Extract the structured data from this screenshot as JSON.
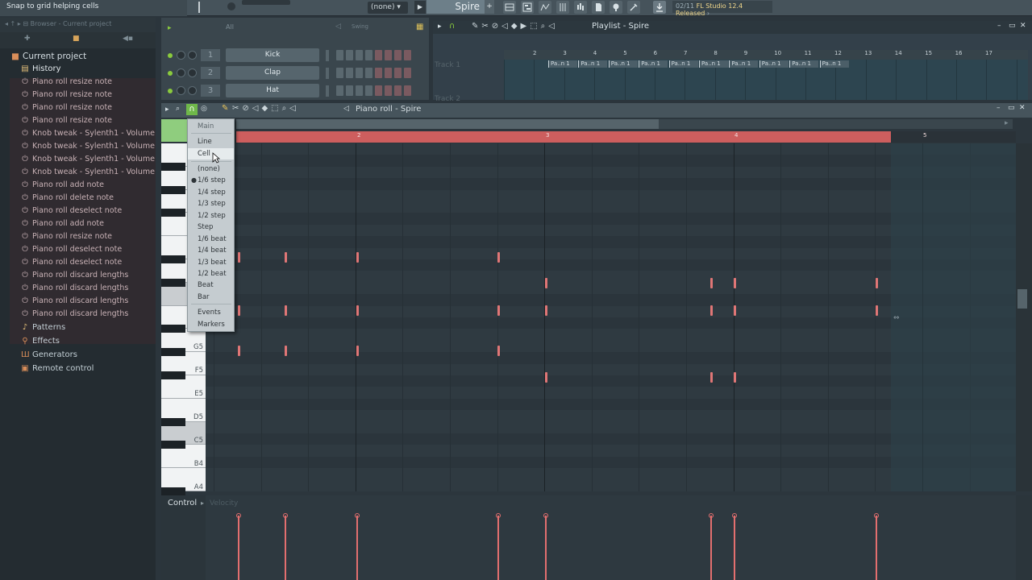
{
  "toolbar": {
    "hint": "Snap to grid helping cells",
    "pattern_select": "(none)",
    "pattern_name": "Spire",
    "news_date": "02/11",
    "news_text": "FL Studio 12.4 Released"
  },
  "browser": {
    "header": "Browser - Current project",
    "root": "Current project",
    "history_label": "History",
    "history": [
      "Piano roll resize note",
      "Piano roll resize note",
      "Piano roll resize note",
      "Piano roll resize note",
      "Knob tweak - Sylenth1 - Volume",
      "Knob tweak - Sylenth1 - Volume",
      "Knob tweak - Sylenth1 - Volume",
      "Knob tweak - Sylenth1 - Volume",
      "Piano roll add note",
      "Piano roll delete note",
      "Piano roll deselect note",
      "Piano roll add note",
      "Piano roll resize note",
      "Piano roll deselect note",
      "Piano roll deselect note",
      "Piano roll discard lengths",
      "Piano roll discard lengths",
      "Piano roll discard lengths",
      "Piano roll discard lengths"
    ],
    "folders": [
      "Patterns",
      "Effects",
      "Generators",
      "Remote control"
    ]
  },
  "channel_rack": {
    "filter": "All",
    "swing_label": "Swing",
    "channels": [
      {
        "num": "1",
        "name": "Kick"
      },
      {
        "num": "2",
        "name": "Clap"
      },
      {
        "num": "3",
        "name": "Hat"
      }
    ]
  },
  "playlist": {
    "title": "Playlist - Spire",
    "track1": "Track 1",
    "track2": "Track 2",
    "ruler": [
      "2",
      "3",
      "4",
      "5",
      "6",
      "7",
      "8",
      "9",
      "10",
      "11",
      "12",
      "13",
      "14",
      "15",
      "16",
      "17"
    ],
    "clip_label": "Pa..n 1"
  },
  "piano_roll": {
    "title": "Piano roll - Spire",
    "bars": [
      "2",
      "3",
      "4",
      "5"
    ],
    "key_labels": [
      "G5",
      "F5",
      "E5",
      "D5",
      "C5",
      "B4",
      "A4"
    ],
    "control_label": "Control",
    "control_target": "Velocity"
  },
  "snap_menu": {
    "items": [
      "Main",
      "Line",
      "Cell",
      "(none)",
      "1/6 step",
      "1/4 step",
      "1/3 step",
      "1/2 step",
      "Step",
      "1/6 beat",
      "1/4 beat",
      "1/3 beat",
      "1/2 beat",
      "Beat",
      "Bar",
      "Events",
      "Markers"
    ],
    "selected": "1/6 step",
    "highlighted": "Cell"
  },
  "colors": {
    "loop_bar": "#cd5e5e",
    "note": "#e07676",
    "accent_green": "#8acb3d"
  }
}
